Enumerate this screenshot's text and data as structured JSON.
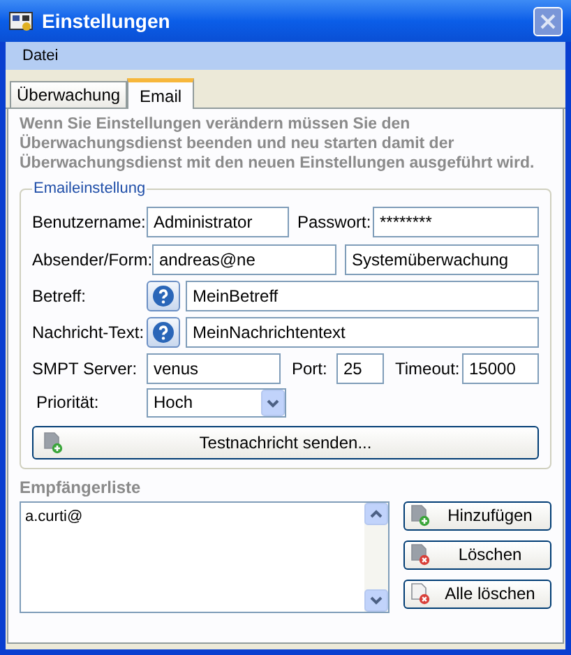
{
  "window": {
    "title": "Einstellungen"
  },
  "menu": [
    "Datei"
  ],
  "tabs": [
    {
      "label": "Überwachung",
      "selected": false
    },
    {
      "label": "Email",
      "selected": true
    }
  ],
  "notice": "Wenn Sie Einstellungen verändern müssen Sie den Überwachungsdienst beenden und neu starten damit der Überwachungsdienst mit den neuen Einstellungen ausgeführt wird.",
  "email_settings": {
    "title": "Emaileinstellung",
    "username": {
      "label": "Benutzername:",
      "value": "Administrator"
    },
    "password": {
      "label": "Passwort:",
      "value": "********"
    },
    "sender": {
      "label": "Absender/Form:",
      "address": "andreas@ne",
      "name": "Systemüberwachung"
    },
    "subject": {
      "label": "Betreff:",
      "value": "MeinBetreff"
    },
    "message": {
      "label": "Nachricht-Text:",
      "value": "MeinNachrichtentext"
    },
    "smtp": {
      "label": "SMPT Server:",
      "value": "venus"
    },
    "port": {
      "label": "Port:",
      "value": "25"
    },
    "timeout": {
      "label": "Timeout:",
      "value": "15000"
    },
    "priority": {
      "label": "Priorität:",
      "value": "Hoch"
    },
    "test_button": "Testnachricht senden..."
  },
  "recipients": {
    "title": "Empfängerliste",
    "items": [
      "a.curti@"
    ],
    "buttons": [
      {
        "label": "Hinzufügen",
        "kind": "add"
      },
      {
        "label": "Löschen",
        "kind": "delete"
      },
      {
        "label": "Alle löschen",
        "kind": "delete_all"
      }
    ]
  }
}
